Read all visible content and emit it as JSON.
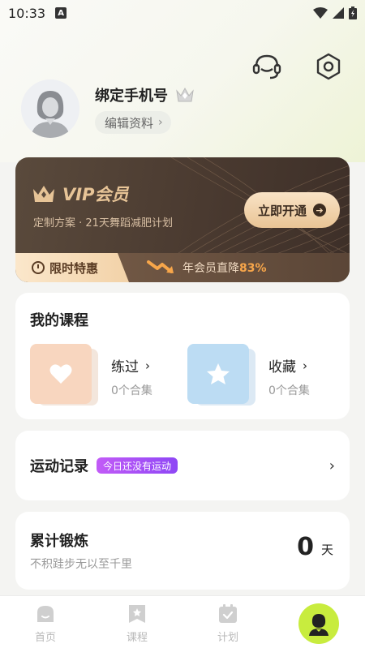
{
  "status_bar": {
    "time": "10:33",
    "indicator": "A"
  },
  "header": {
    "support_icon": "headset-icon",
    "settings_icon": "settings-hexagon-icon"
  },
  "profile": {
    "name": "绑定手机号",
    "edit_label": "编辑资料"
  },
  "vip": {
    "title": "VIP会员",
    "subtitle": "定制方案 · 21天舞蹈减肥计划",
    "button_label": "立即开通",
    "limited_label": "限时特惠",
    "discount_text": "年会员直降",
    "discount_value": "83%"
  },
  "courses": {
    "title": "我的课程",
    "items": [
      {
        "label": "练过",
        "count": "0个合集",
        "icon": "heart-icon"
      },
      {
        "label": "收藏",
        "count": "0个合集",
        "icon": "star-icon"
      }
    ]
  },
  "records": {
    "title": "运动记录",
    "badge": "今日还没有运动"
  },
  "total": {
    "title": "累计锻炼",
    "subtitle": "不积跬步无以至千里",
    "value": "0",
    "unit": "天"
  },
  "tabs": [
    {
      "label": "首页",
      "icon": "home-icon"
    },
    {
      "label": "课程",
      "icon": "course-icon"
    },
    {
      "label": "计划",
      "icon": "plan-icon"
    },
    {
      "label": "",
      "icon": "profile-icon"
    }
  ],
  "colors": {
    "accent": "#c8ec3e",
    "vip_gold": "#e7c497",
    "badge_purple": "#a34ff6"
  }
}
